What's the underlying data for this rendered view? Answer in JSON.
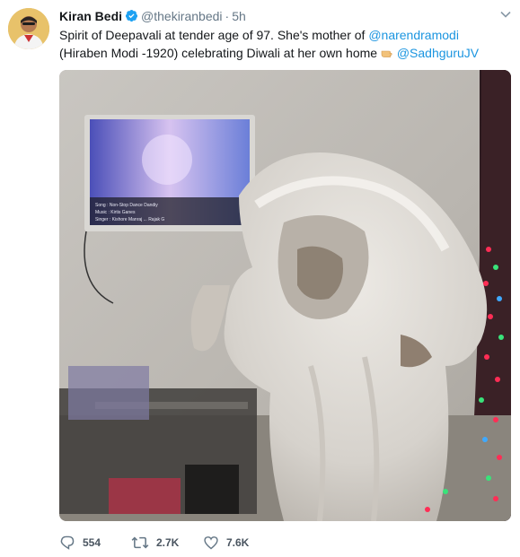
{
  "tweet": {
    "author_name": "Kiran Bedi",
    "author_handle": "@thekiranbedi",
    "separator": "·",
    "timestamp": "5h",
    "text_part1": "Spirit of Deepavali at tender age of 97. She's mother of ",
    "mention1": "@narendramodi",
    "text_part2": "(Hiraben Modi -1920) celebrating Diwali at her own home",
    "emoji_name": "backhand-index-pointing-right-icon",
    "mention2": "@SadhguruJV",
    "tv_lines": {
      "song": "Song :",
      "song_value": "Non-Stop Dance Dandiy",
      "music": "Music :",
      "music_value": "Kirtis Ganes",
      "singer": "Singer :",
      "singer_value": "Kishore Manraj ... Rajak G"
    },
    "replies": "554",
    "retweets": "2.7K",
    "likes": "7.6K"
  },
  "colors": {
    "link": "#1b95e0",
    "verified": "#1da1f2",
    "muted": "#657786",
    "text": "#14171a"
  }
}
